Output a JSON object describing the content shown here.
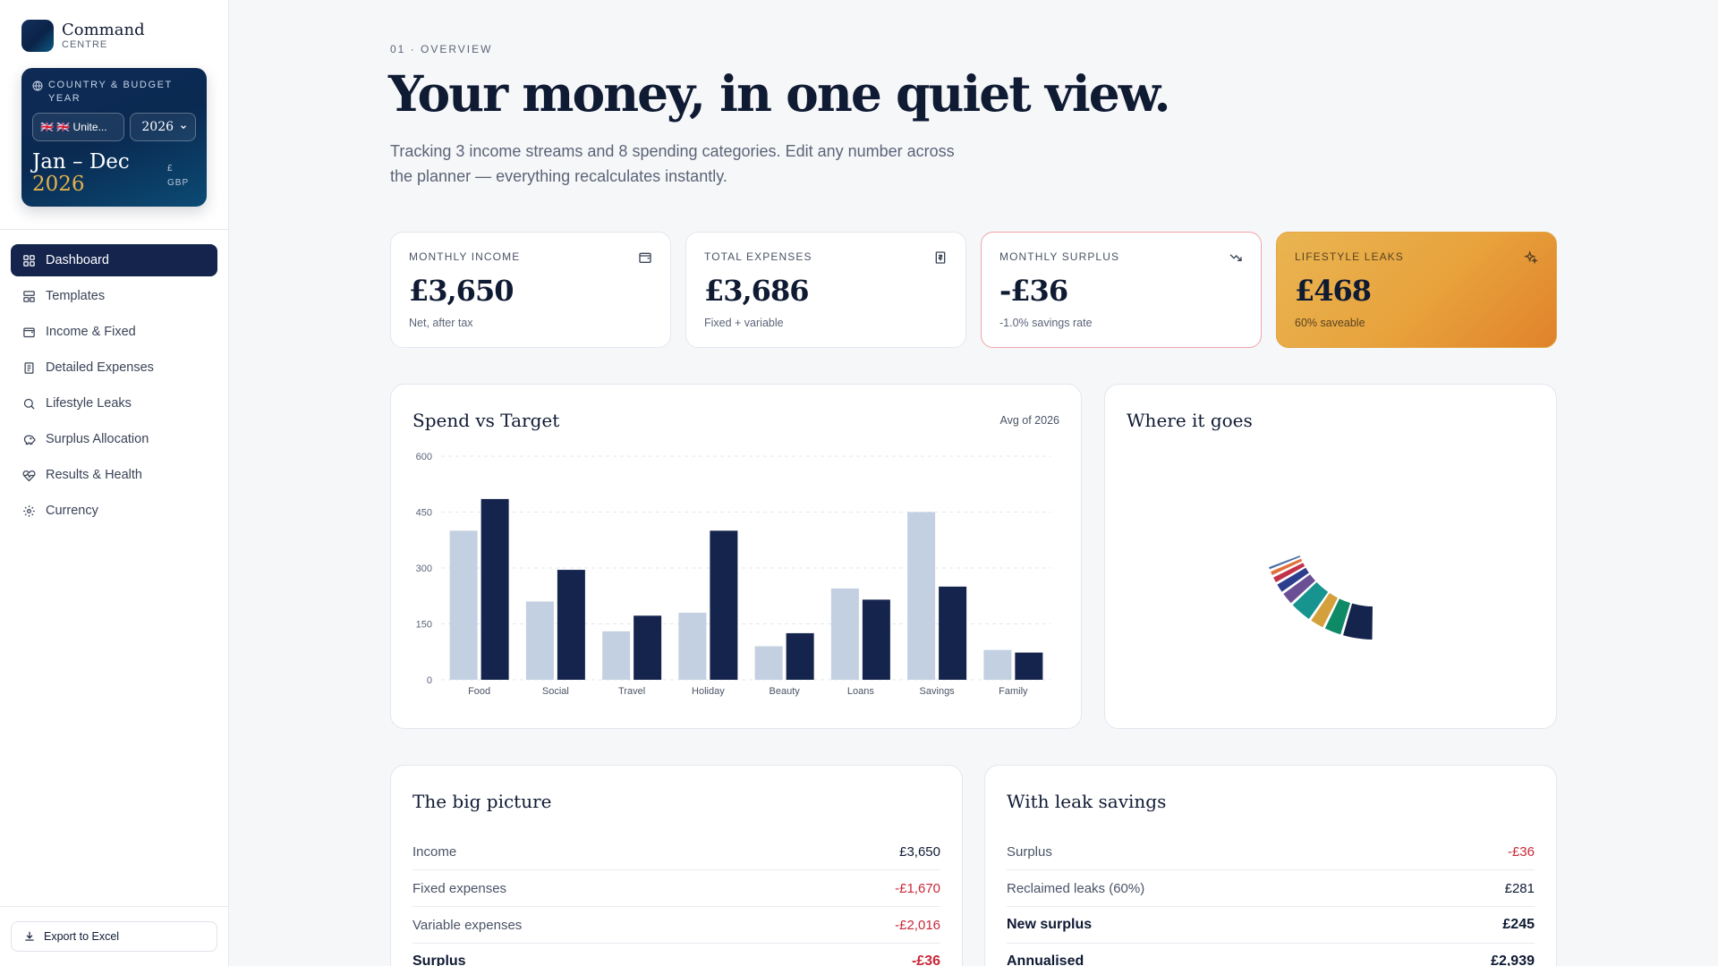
{
  "brand": {
    "title": "Command",
    "subtitle": "CENTRE"
  },
  "budget_card": {
    "heading_line1": "COUNTRY & BUDGET",
    "heading_line2": "YEAR",
    "country_value": "🇬🇧 🇬🇧 Unite...",
    "year_value": "2026",
    "period_range": "Jan – Dec",
    "period_year": "2026",
    "currency_symbol": "£",
    "currency_code": "GBP"
  },
  "nav": [
    {
      "label": "Dashboard",
      "icon": "grid-icon",
      "active": true
    },
    {
      "label": "Templates",
      "icon": "template-icon"
    },
    {
      "label": "Income & Fixed",
      "icon": "wallet-icon"
    },
    {
      "label": "Detailed Expenses",
      "icon": "receipt-icon"
    },
    {
      "label": "Lifestyle Leaks",
      "icon": "search-icon"
    },
    {
      "label": "Surplus Allocation",
      "icon": "piggy-bank-icon"
    },
    {
      "label": "Results & Health",
      "icon": "heart-pulse-icon"
    },
    {
      "label": "Currency",
      "icon": "gear-icon"
    }
  ],
  "export_label": "Export to Excel",
  "header": {
    "eyebrow": "01 · OVERVIEW",
    "title": "Your money, in one quiet view.",
    "subtitle": "Tracking 3 income streams and 8 spending categories. Edit any number across the planner — everything recalculates instantly."
  },
  "kpis": [
    {
      "label": "MONTHLY INCOME",
      "value": "£3,650",
      "note": "Net, after tax",
      "icon": "wallet-icon"
    },
    {
      "label": "TOTAL EXPENSES",
      "value": "£3,686",
      "note": "Fixed + variable",
      "icon": "receipt-icon"
    },
    {
      "label": "MONTHLY SURPLUS",
      "value": "-£36",
      "note": "-1.0% savings rate",
      "icon": "trend-down-icon"
    },
    {
      "label": "LIFESTYLE LEAKS",
      "value": "£468",
      "note": "60% saveable",
      "icon": "sparkles-icon"
    }
  ],
  "spend_panel": {
    "title": "Spend vs Target",
    "meta": "Avg of 2026"
  },
  "where_panel": {
    "title": "Where it goes"
  },
  "chart_data": [
    {
      "type": "bar",
      "title": "Spend vs Target",
      "categories": [
        "Food",
        "Social",
        "Travel",
        "Holiday",
        "Beauty",
        "Loans",
        "Savings",
        "Family"
      ],
      "series": [
        {
          "values": [
            400,
            210,
            130,
            180,
            90,
            245,
            450,
            80
          ],
          "color": "#c2d0e1"
        },
        {
          "values": [
            485,
            295,
            172,
            400,
            125,
            215,
            250,
            73
          ],
          "color": "#15244d"
        }
      ],
      "ylim": [
        0,
        600
      ],
      "yticks": [
        0,
        150,
        300,
        450,
        600
      ],
      "grid": true
    },
    {
      "type": "pie",
      "title": "Where it goes",
      "slices": [
        {
          "value": 20,
          "color": "#15244d"
        },
        {
          "value": 12,
          "color": "#0f8a66"
        },
        {
          "value": 10,
          "color": "#d4a03c"
        },
        {
          "value": 15,
          "color": "#17948f"
        },
        {
          "value": 9,
          "color": "#6b4f94"
        },
        {
          "value": 7,
          "color": "#2d3e8c"
        },
        {
          "value": 5,
          "color": "#c2334a"
        },
        {
          "value": 4,
          "color": "#e0713c"
        },
        {
          "value": 3,
          "color": "#4a6fa5"
        }
      ]
    }
  ],
  "big_picture": {
    "title": "The big picture",
    "rows": [
      {
        "label": "Income",
        "value": "£3,650",
        "neg": false,
        "strong": false
      },
      {
        "label": "Fixed expenses",
        "value": "-£1,670",
        "neg": true,
        "strong": false
      },
      {
        "label": "Variable expenses",
        "value": "-£2,016",
        "neg": true,
        "strong": false
      },
      {
        "label": "Surplus",
        "value": "-£36",
        "neg": true,
        "strong": true
      }
    ]
  },
  "leak_savings": {
    "title": "With leak savings",
    "rows": [
      {
        "label": "Surplus",
        "value": "-£36",
        "neg": true,
        "strong": false
      },
      {
        "label": "Reclaimed leaks (60%)",
        "value": "£281",
        "neg": false,
        "strong": false
      },
      {
        "label": "New surplus",
        "value": "£245",
        "neg": false,
        "strong": true
      },
      {
        "label": "Annualised",
        "value": "£2,939",
        "neg": false,
        "strong": true
      }
    ]
  }
}
